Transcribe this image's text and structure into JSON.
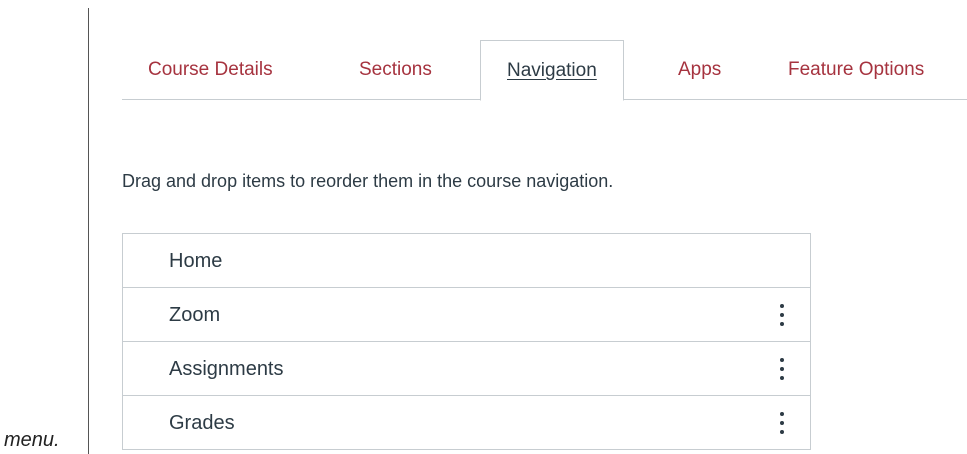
{
  "caption": {
    "text": "menu."
  },
  "tabs": [
    {
      "label": "Course Details",
      "active": false
    },
    {
      "label": "Sections",
      "active": false
    },
    {
      "label": "Navigation",
      "active": true
    },
    {
      "label": "Apps",
      "active": false
    },
    {
      "label": "Feature Options",
      "active": false
    }
  ],
  "main": {
    "instructions": "Drag and drop items to reorder them in the course navigation."
  },
  "nav_items": [
    {
      "label": "Home",
      "has_menu": false
    },
    {
      "label": "Zoom",
      "has_menu": true
    },
    {
      "label": "Assignments",
      "has_menu": true
    },
    {
      "label": "Grades",
      "has_menu": true
    }
  ],
  "colors": {
    "tab_link": "#a6333f",
    "text": "#2d3b45",
    "border": "#c7cdd1"
  },
  "icons": {
    "item_menu": "vertical-ellipsis-icon"
  }
}
